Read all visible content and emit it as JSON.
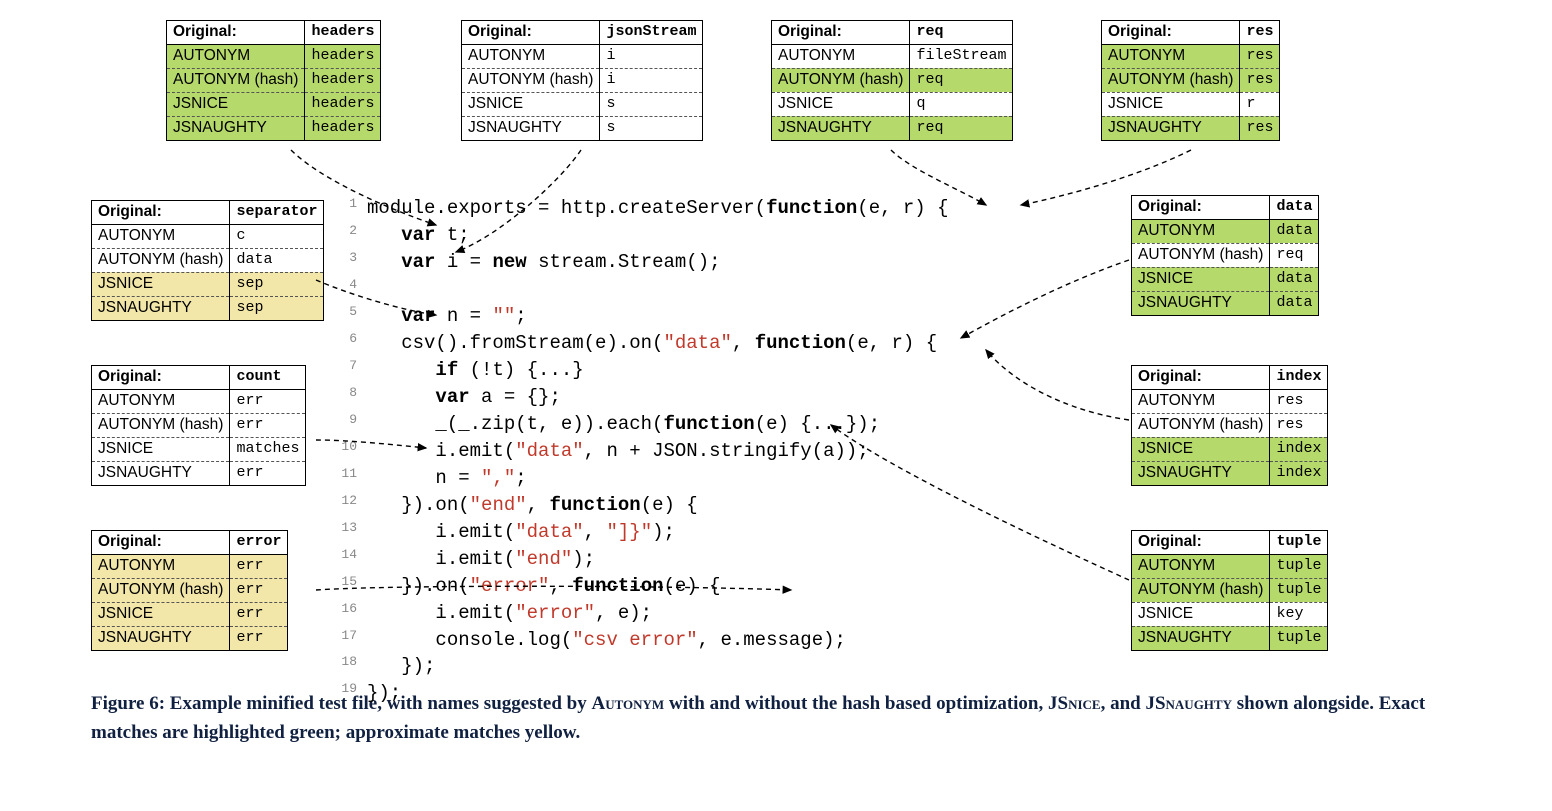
{
  "tables": {
    "headers": {
      "original": "headers",
      "rows": [
        [
          "AUTONYM",
          "headers",
          "green"
        ],
        [
          "AUTONYM (hash)",
          "headers",
          "green"
        ],
        [
          "JSNICE",
          "headers",
          "green"
        ],
        [
          "JSNAUGHTY",
          "headers",
          "green"
        ]
      ]
    },
    "jsonStream": {
      "original": "jsonStream",
      "rows": [
        [
          "AUTONYM",
          "i",
          ""
        ],
        [
          "AUTONYM (hash)",
          "i",
          ""
        ],
        [
          "JSNICE",
          "s",
          ""
        ],
        [
          "JSNAUGHTY",
          "s",
          ""
        ]
      ]
    },
    "req": {
      "original": "req",
      "rows": [
        [
          "AUTONYM",
          "fileStream",
          ""
        ],
        [
          "AUTONYM (hash)",
          "req",
          "green"
        ],
        [
          "JSNICE",
          "q",
          ""
        ],
        [
          "JSNAUGHTY",
          "req",
          "green"
        ]
      ]
    },
    "res": {
      "original": "res",
      "rows": [
        [
          "AUTONYM",
          "res",
          "green"
        ],
        [
          "AUTONYM (hash)",
          "res",
          "green"
        ],
        [
          "JSNICE",
          "r",
          ""
        ],
        [
          "JSNAUGHTY",
          "res",
          "green"
        ]
      ]
    },
    "separator": {
      "original": "separator",
      "rows": [
        [
          "AUTONYM",
          "c",
          ""
        ],
        [
          "AUTONYM (hash)",
          "data",
          ""
        ],
        [
          "JSNICE",
          "sep",
          "yellow"
        ],
        [
          "JSNAUGHTY",
          "sep",
          "yellow"
        ]
      ]
    },
    "count": {
      "original": "count",
      "rows": [
        [
          "AUTONYM",
          "err",
          ""
        ],
        [
          "AUTONYM (hash)",
          "err",
          ""
        ],
        [
          "JSNICE",
          "matches",
          ""
        ],
        [
          "JSNAUGHTY",
          "err",
          ""
        ]
      ]
    },
    "error": {
      "original": "error",
      "rows": [
        [
          "AUTONYM",
          "err",
          "yellow"
        ],
        [
          "AUTONYM (hash)",
          "err",
          "yellow"
        ],
        [
          "JSNICE",
          "err",
          "yellow"
        ],
        [
          "JSNAUGHTY",
          "err",
          "yellow"
        ]
      ]
    },
    "data": {
      "original": "data",
      "rows": [
        [
          "AUTONYM",
          "data",
          "green"
        ],
        [
          "AUTONYM (hash)",
          "req",
          ""
        ],
        [
          "JSNICE",
          "data",
          "green"
        ],
        [
          "JSNAUGHTY",
          "data",
          "green"
        ]
      ]
    },
    "index": {
      "original": "index",
      "rows": [
        [
          "AUTONYM",
          "res",
          ""
        ],
        [
          "AUTONYM (hash)",
          "res",
          ""
        ],
        [
          "JSNICE",
          "index",
          "green"
        ],
        [
          "JSNAUGHTY",
          "index",
          "green"
        ]
      ]
    },
    "tuple": {
      "original": "tuple",
      "rows": [
        [
          "AUTONYM",
          "tuple",
          "green"
        ],
        [
          "AUTONYM (hash)",
          "tuple",
          "green"
        ],
        [
          "JSNICE",
          "key",
          ""
        ],
        [
          "JSNAUGHTY",
          "tuple",
          "green"
        ]
      ]
    }
  },
  "labels": {
    "original": "Original:"
  },
  "code": {
    "l1": "module.exports = http.createServer(",
    "l1b": "(e, r) {",
    "l2": " t;",
    "l3a": " i = ",
    "l3b": " stream.Stream();",
    "l5": " n = ",
    "l5s": "\"\"",
    "l6a": "csv().fromStream(e).on(",
    "l6s": "\"data\"",
    "l6b": ", ",
    "l6c": "(e, r) {",
    "l7": " (!t) {...}",
    "l8": " a = {};",
    "l9": "_(_.zip(t, e)).each(",
    "l9b": "(e) {...});",
    "l10a": "i.emit(",
    "l10s": "\"data\"",
    "l10b": ", n + JSON.stringify(a));",
    "l11": "n = ",
    "l11s": "\",\"",
    "l12a": "}).on(",
    "l12s": "\"end\"",
    "l12b": ", ",
    "l12c": "(e) {",
    "l13a": "i.emit(",
    "l13s": "\"data\"",
    "l13b": ", ",
    "l13c": "\"]}\"",
    "l13d": ");",
    "l14a": "i.emit(",
    "l14s": "\"end\"",
    "l14b": ");",
    "l15a": "}).on(",
    "l15s": "\"error\"",
    "l15b": ", ",
    "l15c": "(e) {",
    "l16a": "i.emit(",
    "l16s": "\"error\"",
    "l16b": ", e);",
    "l17a": "console.log(",
    "l17s": "\"csv error\"",
    "l17b": ", e.message);",
    "l18": "});",
    "l19": "});",
    "kw_function": "function",
    "kw_var": "var",
    "kw_new": "new",
    "kw_if": "if"
  },
  "caption": {
    "prefix": "Figure 6: Example minified test file, with names suggested by ",
    "autonym": "Autonym",
    "mid1": " with and without the hash based optimization, ",
    "jsnice": "JSnice",
    "mid2": ", and ",
    "jsnaughty": "JSnaughty",
    "suffix": " shown alongside. Exact matches are highlighted green; approximate matches yellow."
  }
}
